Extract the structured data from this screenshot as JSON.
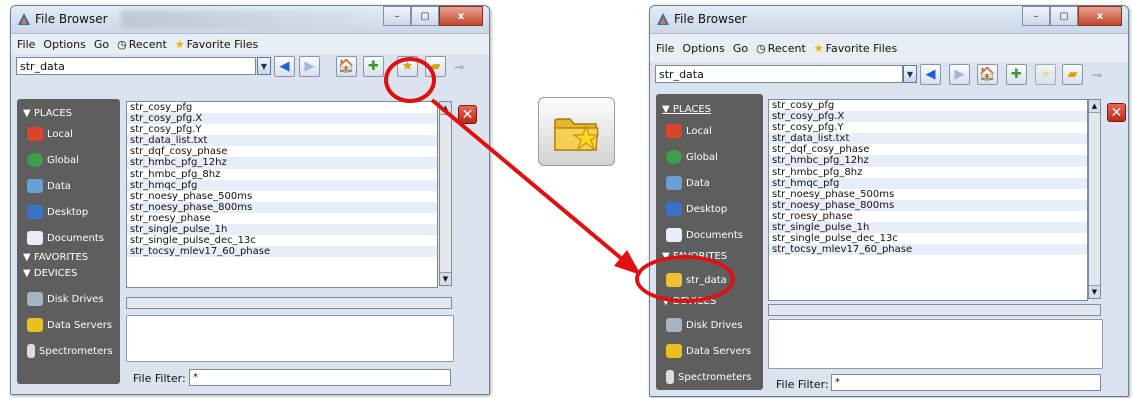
{
  "window": {
    "title": "File Browser",
    "min_label": "–",
    "max_label": "▢",
    "close_label": "x"
  },
  "menu": {
    "file": "File",
    "options": "Options",
    "go": "Go",
    "recent": "Recent",
    "favorites": "Favorite Files"
  },
  "path": {
    "value": "str_data"
  },
  "sidebar": {
    "places_header": "PLACES",
    "favorites_header": "FAVORITES",
    "devices_header": "DEVICES",
    "places": [
      "Local",
      "Global",
      "Data",
      "Desktop",
      "Documents"
    ],
    "favorites": [
      "str_data"
    ],
    "devices": [
      "Disk Drives",
      "Data Servers",
      "Spectrometers"
    ]
  },
  "files": [
    "str_cosy_pfg",
    "str_cosy_pfg.X",
    "str_cosy_pfg.Y",
    "str_data_list.txt",
    "str_dqf_cosy_phase",
    "str_hmbc_pfg_12hz",
    "str_hmbc_pfg_8hz",
    "str_hmqc_pfg",
    "str_noesy_phase_500ms",
    "str_noesy_phase_800ms",
    "str_roesy_phase",
    "str_single_pulse_1h",
    "str_single_pulse_dec_13c",
    "str_tocsy_mlev17_60_phase"
  ],
  "filter": {
    "label": "File Filter:",
    "value": "*"
  },
  "colors": {
    "highlight": "#e01010",
    "sidebar_bg": "#5e5e5e"
  },
  "icons": {
    "add_favorite": "folder-star-icon"
  }
}
